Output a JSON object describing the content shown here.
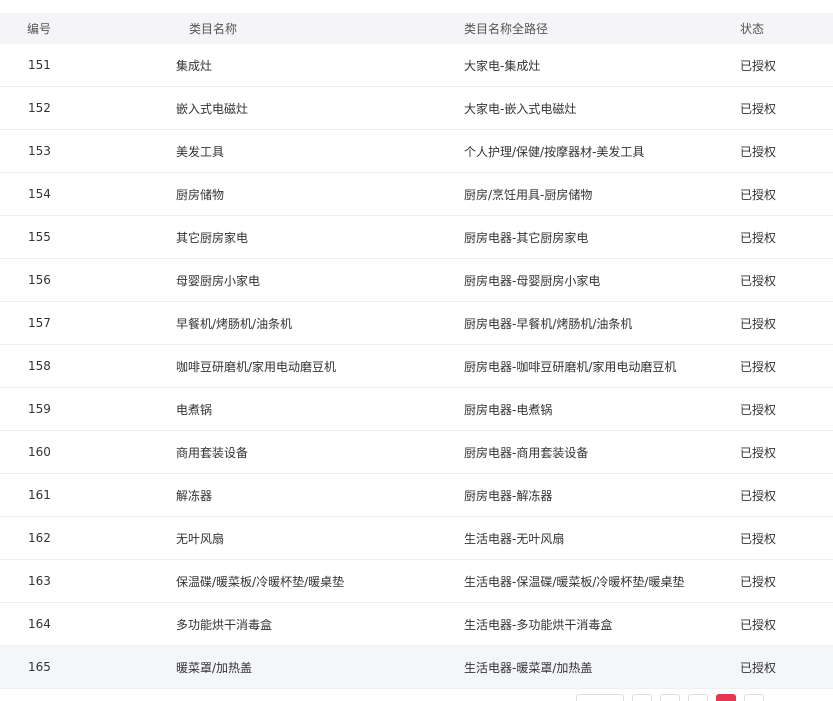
{
  "table": {
    "headers": {
      "id": "编号",
      "name": "类目名称",
      "path": "类目名称全路径",
      "status": "状态"
    },
    "rows": [
      {
        "id": "151",
        "name": "集成灶",
        "path": "大家电-集成灶",
        "status": "已授权"
      },
      {
        "id": "152",
        "name": "嵌入式电磁灶",
        "path": "大家电-嵌入式电磁灶",
        "status": "已授权"
      },
      {
        "id": "153",
        "name": "美发工具",
        "path": "个人护理/保健/按摩器材-美发工具",
        "status": "已授权"
      },
      {
        "id": "154",
        "name": "厨房储物",
        "path": "厨房/烹饪用具-厨房储物",
        "status": "已授权"
      },
      {
        "id": "155",
        "name": "其它厨房家电",
        "path": "厨房电器-其它厨房家电",
        "status": "已授权"
      },
      {
        "id": "156",
        "name": "母婴厨房小家电",
        "path": "厨房电器-母婴厨房小家电",
        "status": "已授权"
      },
      {
        "id": "157",
        "name": "早餐机/烤肠机/油条机",
        "path": "厨房电器-早餐机/烤肠机/油条机",
        "status": "已授权"
      },
      {
        "id": "158",
        "name": "咖啡豆研磨机/家用电动磨豆机",
        "path": "厨房电器-咖啡豆研磨机/家用电动磨豆机",
        "status": "已授权"
      },
      {
        "id": "159",
        "name": "电煮锅",
        "path": "厨房电器-电煮锅",
        "status": "已授权"
      },
      {
        "id": "160",
        "name": "商用套装设备",
        "path": "厨房电器-商用套装设备",
        "status": "已授权"
      },
      {
        "id": "161",
        "name": "解冻器",
        "path": "厨房电器-解冻器",
        "status": "已授权"
      },
      {
        "id": "162",
        "name": "无叶风扇",
        "path": "生活电器-无叶风扇",
        "status": "已授权"
      },
      {
        "id": "163",
        "name": "保温碟/暖菜板/冷暖杯垫/暖桌垫",
        "path": "生活电器-保温碟/暖菜板/冷暖杯垫/暖桌垫",
        "status": "已授权"
      },
      {
        "id": "164",
        "name": "多功能烘干消毒盒",
        "path": "生活电器-多功能烘干消毒盒",
        "status": "已授权"
      },
      {
        "id": "165",
        "name": "暖菜罩/加热盖",
        "path": "生活电器-暖菜罩/加热盖",
        "status": "已授权"
      }
    ]
  },
  "colors": {
    "header_bg": "#f5f5f7",
    "hover_row_bg": "#f5f6fa",
    "active_page": "#e8364e"
  }
}
